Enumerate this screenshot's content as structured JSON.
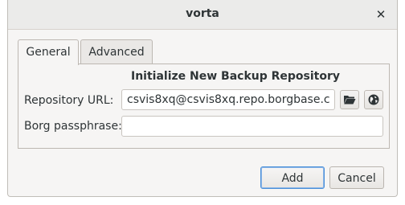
{
  "window": {
    "title": "vorta",
    "close_glyph": "✕"
  },
  "tabs": [
    {
      "label": "General",
      "active": true
    },
    {
      "label": "Advanced",
      "active": false
    }
  ],
  "form": {
    "heading": "Initialize New Backup Repository",
    "repo_url_label": "Repository URL:",
    "repo_url_value": "csvis8xq@csvis8xq.repo.borgbase.co...",
    "passphrase_label": "Borg passphrase:",
    "passphrase_value": ""
  },
  "icons": {
    "open_folder": "folder-open-icon",
    "web": "globe-icon"
  },
  "buttons": {
    "add": "Add",
    "cancel": "Cancel"
  },
  "colors": {
    "default_button_border": "#4a90d9"
  }
}
